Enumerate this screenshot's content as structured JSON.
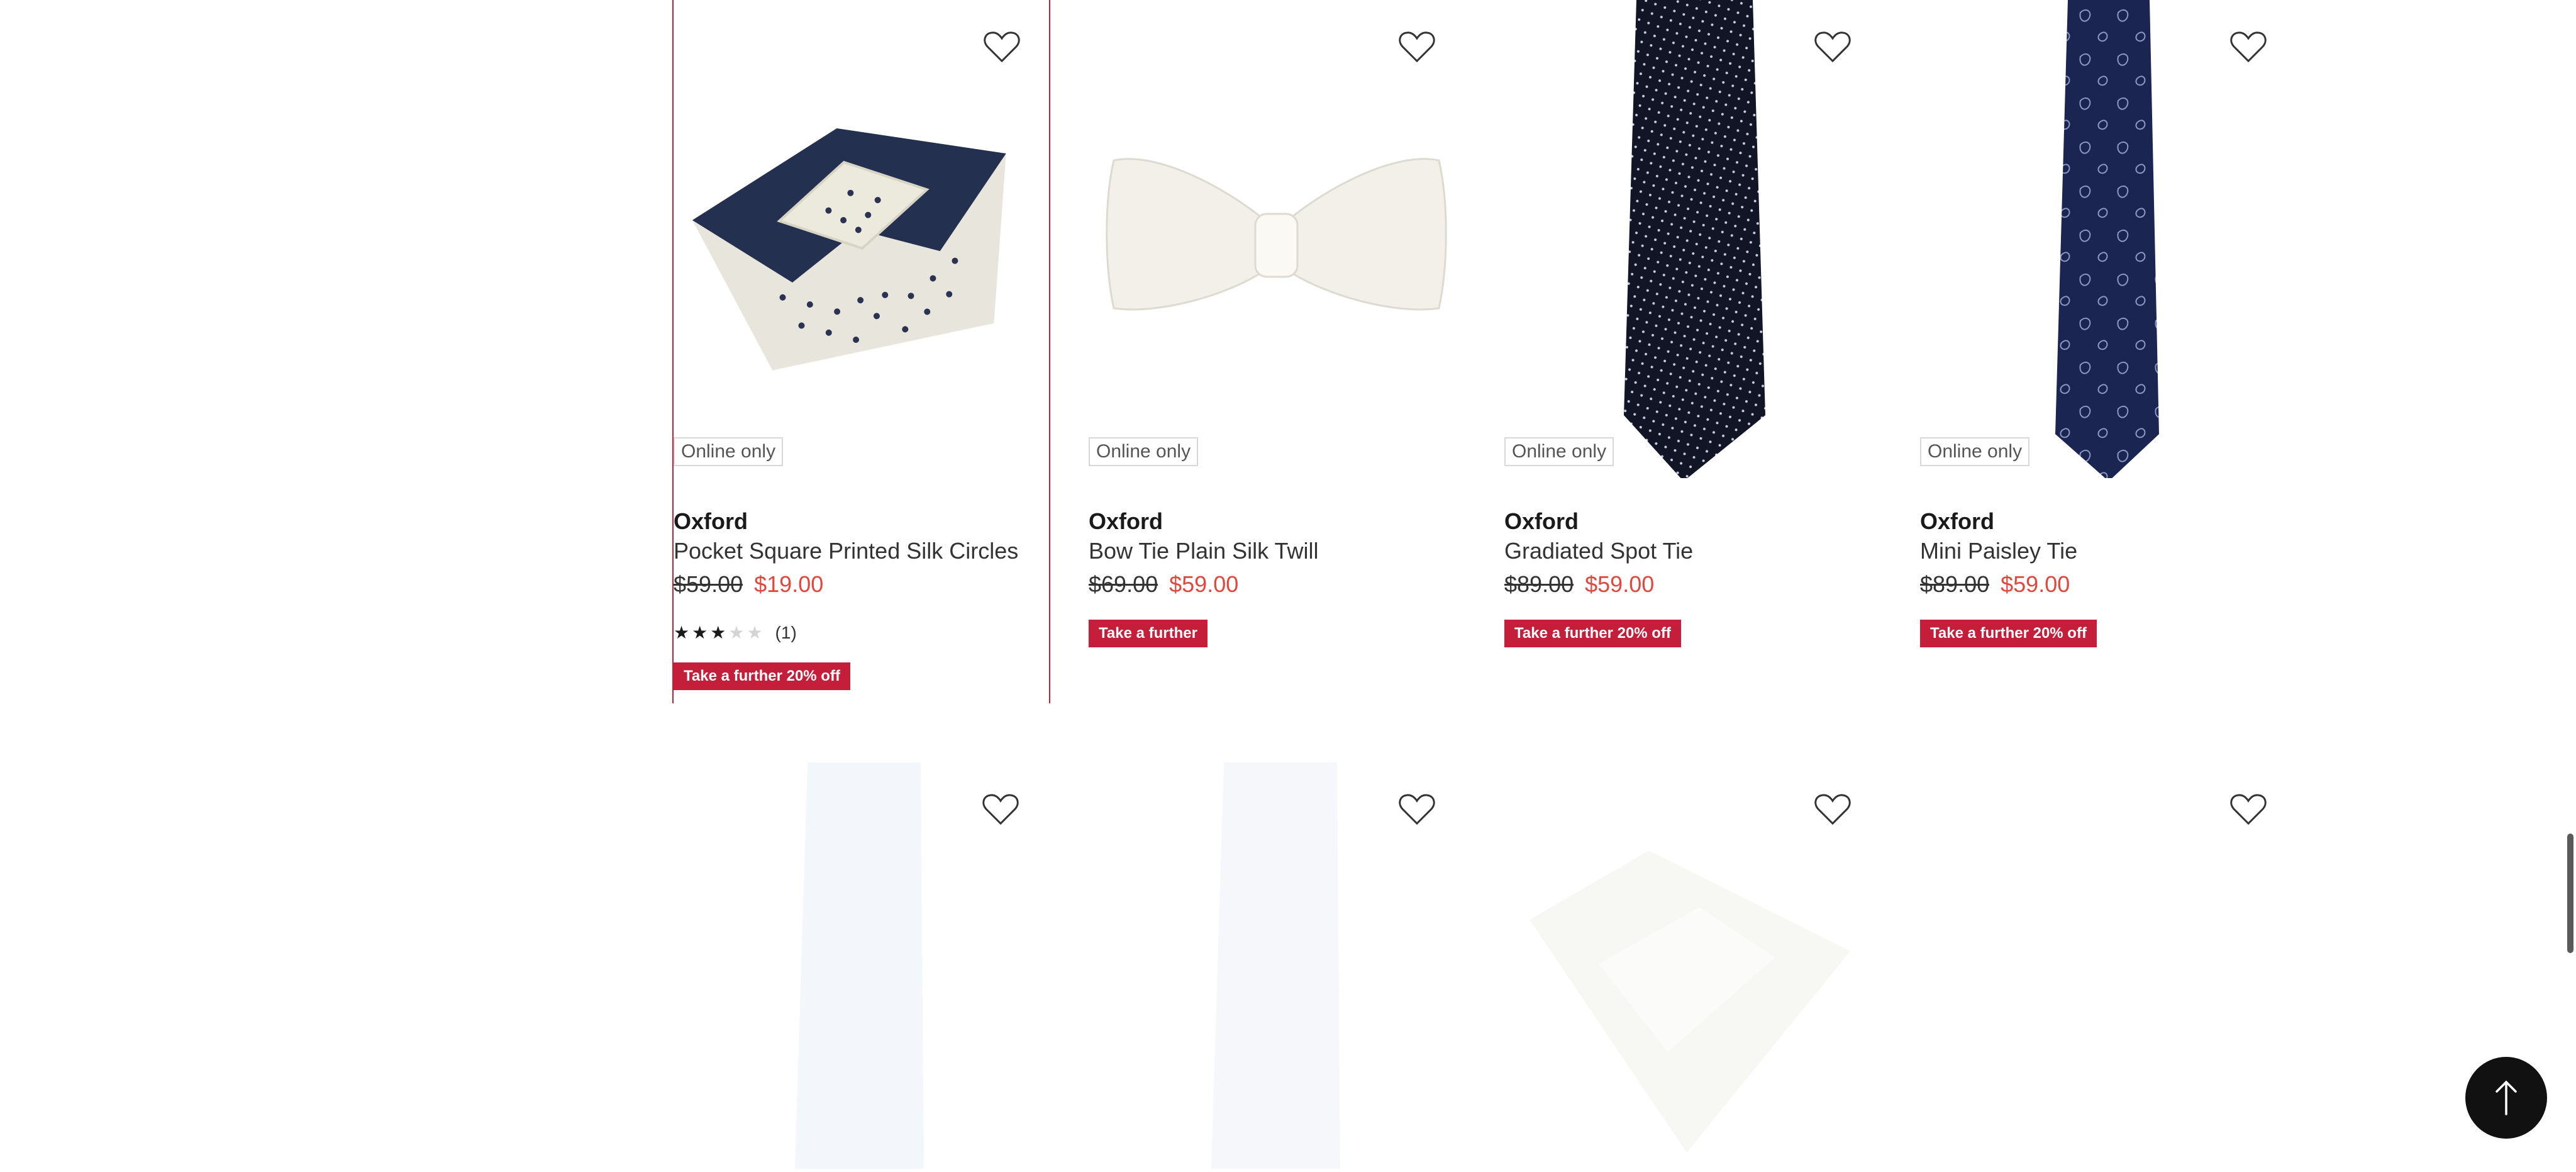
{
  "products": [
    {
      "badge": "Online only",
      "brand": "Oxford",
      "name": "Pocket Square Printed Silk Circles",
      "was_price": "$59.00",
      "now_price": "$19.00",
      "rating_count": "(1)",
      "rating_stars": 3,
      "promo": "Take a further 20% off",
      "image": "navy-pocket-square-with-dots"
    },
    {
      "badge": "Online only",
      "brand": "Oxford",
      "name": "Bow Tie Plain Silk Twill",
      "was_price": "$69.00",
      "now_price": "$59.00",
      "promo": "Take a further",
      "image": "white-bow-tie"
    },
    {
      "badge": "Online only",
      "brand": "Oxford",
      "name": "Gradiated Spot Tie",
      "was_price": "$89.00",
      "now_price": "$59.00",
      "promo": "Take a further 20% off",
      "image": "navy-spot-tie"
    },
    {
      "badge": "Online only",
      "brand": "Oxford",
      "name": "Mini Paisley Tie",
      "was_price": "$89.00",
      "now_price": "$59.00",
      "promo": "Take a further 20% off",
      "image": "navy-paisley-tie"
    }
  ],
  "second_row": [
    {
      "image": "white-tie-faded"
    },
    {
      "image": "white-tie-faded"
    },
    {
      "image": "white-pocket-square-faded"
    },
    {
      "image": "blank"
    }
  ],
  "icons": {
    "wishlist": "heart-outline-icon",
    "back_to_top": "arrow-up-icon"
  },
  "colors": {
    "promo_bg": "#c41e3a",
    "sale_price": "#e0483e",
    "selection_border": "#c41e3a"
  }
}
